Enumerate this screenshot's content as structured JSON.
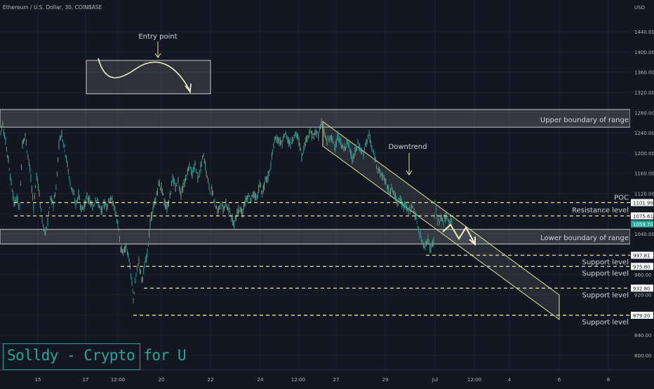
{
  "header": {
    "symbol_line": "Ethereum / U.S. Dollar, 30, COINBASE"
  },
  "colors": {
    "background": "#131722",
    "grid": "#1e222d",
    "candle": "#26a69a",
    "candle_down": "#7aa08a",
    "annotation": "#e6e39a",
    "last_price_bg": "#26a69a",
    "label_bg": "#ffffff"
  },
  "watermark": {
    "text": "Solldy - Crypto for U",
    "color": "#26a69a"
  },
  "chart_data": {
    "type": "candlestick",
    "title": "Ethereum / U.S. Dollar, 30, COINBASE",
    "currency": "USD",
    "y_ticks": [
      800,
      840,
      880,
      920,
      960,
      1000,
      1040,
      1080,
      1120,
      1160,
      1200,
      1240,
      1280,
      1320,
      1360,
      1400,
      1440
    ],
    "y_tick_labels": [
      "800.00",
      "840.00",
      "880.00",
      "920.00",
      "960.00",
      "1000.00",
      "1040.00",
      "1080.00",
      "1120.00",
      "1160.00",
      "1200.00",
      "1240.00",
      "1280.00",
      "1320.00",
      "1360.00",
      "1400.00",
      "1440.00"
    ],
    "ylim": [
      779,
      1496
    ],
    "x_ticks": [
      "15",
      "17",
      "12:00",
      "20",
      "22",
      "24",
      "12:00",
      "27",
      "29",
      "Jul",
      "12:00",
      "4",
      "6",
      "8"
    ],
    "last_price": 1059.7,
    "last_price_label": "1059.70",
    "price_series": [
      [
        0,
        1236
      ],
      [
        4,
        1258
      ],
      [
        8,
        1222
      ],
      [
        12,
        1186
      ],
      [
        16,
        1140
      ],
      [
        20,
        1102
      ],
      [
        24,
        1110
      ],
      [
        28,
        1094
      ],
      [
        32,
        1220
      ],
      [
        36,
        1234
      ],
      [
        40,
        1194
      ],
      [
        44,
        1148
      ],
      [
        48,
        1094
      ],
      [
        52,
        1156
      ],
      [
        56,
        1120
      ],
      [
        60,
        1066
      ],
      [
        64,
        1040
      ],
      [
        68,
        1062
      ],
      [
        72,
        1108
      ],
      [
        76,
        1098
      ],
      [
        80,
        1132
      ],
      [
        84,
        1220
      ],
      [
        88,
        1240
      ],
      [
        92,
        1210
      ],
      [
        96,
        1176
      ],
      [
        100,
        1140
      ],
      [
        104,
        1122
      ],
      [
        108,
        1098
      ],
      [
        112,
        1118
      ],
      [
        116,
        1090
      ],
      [
        120,
        1096
      ],
      [
        124,
        1114
      ],
      [
        128,
        1104
      ],
      [
        132,
        1092
      ],
      [
        136,
        1110
      ],
      [
        140,
        1100
      ],
      [
        144,
        1084
      ],
      [
        148,
        1100
      ],
      [
        152,
        1096
      ],
      [
        156,
        1108
      ],
      [
        160,
        1104
      ],
      [
        164,
        1086
      ],
      [
        168,
        1060
      ],
      [
        172,
        1008
      ],
      [
        176,
        1004
      ],
      [
        180,
        1016
      ],
      [
        184,
        990
      ],
      [
        188,
        940
      ],
      [
        190,
        912
      ],
      [
        194,
        958
      ],
      [
        198,
        986
      ],
      [
        202,
        948
      ],
      [
        206,
        976
      ],
      [
        210,
        1004
      ],
      [
        214,
        1060
      ],
      [
        218,
        1090
      ],
      [
        222,
        1106
      ],
      [
        226,
        1140
      ],
      [
        230,
        1132
      ],
      [
        234,
        1104
      ],
      [
        238,
        1090
      ],
      [
        242,
        1116
      ],
      [
        246,
        1150
      ],
      [
        250,
        1130
      ],
      [
        254,
        1146
      ],
      [
        258,
        1118
      ],
      [
        262,
        1138
      ],
      [
        266,
        1154
      ],
      [
        270,
        1172
      ],
      [
        274,
        1160
      ],
      [
        278,
        1176
      ],
      [
        282,
        1152
      ],
      [
        286,
        1170
      ],
      [
        290,
        1198
      ],
      [
        294,
        1160
      ],
      [
        298,
        1132
      ],
      [
        302,
        1124
      ],
      [
        306,
        1104
      ],
      [
        310,
        1084
      ],
      [
        314,
        1100
      ],
      [
        318,
        1088
      ],
      [
        322,
        1100
      ],
      [
        326,
        1086
      ],
      [
        330,
        1072
      ],
      [
        334,
        1062
      ],
      [
        338,
        1082
      ],
      [
        342,
        1090
      ],
      [
        346,
        1082
      ],
      [
        350,
        1106
      ],
      [
        354,
        1112
      ],
      [
        358,
        1108
      ],
      [
        362,
        1120
      ],
      [
        366,
        1112
      ],
      [
        370,
        1138
      ],
      [
        374,
        1120
      ],
      [
        378,
        1144
      ],
      [
        382,
        1152
      ],
      [
        386,
        1178
      ],
      [
        390,
        1216
      ],
      [
        394,
        1230
      ],
      [
        398,
        1224
      ],
      [
        402,
        1216
      ],
      [
        406,
        1238
      ],
      [
        410,
        1228
      ],
      [
        414,
        1218
      ],
      [
        418,
        1232
      ],
      [
        422,
        1236
      ],
      [
        426,
        1224
      ],
      [
        430,
        1192
      ],
      [
        434,
        1216
      ],
      [
        438,
        1232
      ],
      [
        442,
        1244
      ],
      [
        446,
        1232
      ],
      [
        450,
        1240
      ],
      [
        454,
        1236
      ],
      [
        458,
        1262
      ],
      [
        462,
        1238
      ],
      [
        466,
        1222
      ],
      [
        470,
        1230
      ],
      [
        474,
        1224
      ],
      [
        478,
        1214
      ],
      [
        482,
        1232
      ],
      [
        486,
        1220
      ],
      [
        490,
        1206
      ],
      [
        494,
        1222
      ],
      [
        498,
        1210
      ],
      [
        502,
        1186
      ],
      [
        506,
        1200
      ],
      [
        510,
        1220
      ],
      [
        514,
        1206
      ],
      [
        518,
        1198
      ],
      [
        522,
        1222
      ],
      [
        526,
        1236
      ],
      [
        530,
        1208
      ],
      [
        534,
        1190
      ],
      [
        538,
        1172
      ],
      [
        542,
        1160
      ],
      [
        546,
        1154
      ],
      [
        550,
        1140
      ],
      [
        554,
        1124
      ],
      [
        558,
        1130
      ],
      [
        562,
        1118
      ],
      [
        566,
        1104
      ],
      [
        570,
        1110
      ],
      [
        574,
        1094
      ],
      [
        578,
        1098
      ],
      [
        582,
        1082
      ],
      [
        586,
        1094
      ],
      [
        590,
        1086
      ],
      [
        594,
        1064
      ],
      [
        598,
        1040
      ],
      [
        602,
        1024
      ],
      [
        606,
        1016
      ],
      [
        610,
        1030
      ],
      [
        614,
        1008
      ],
      [
        618,
        1024
      ],
      [
        620,
        1102
      ],
      [
        624,
        1062
      ],
      [
        628,
        1072
      ],
      [
        632,
        1064
      ],
      [
        636,
        1076
      ],
      [
        640,
        1060
      ],
      [
        644,
        1068
      ]
    ],
    "annotations": {
      "entry_point": "Entry point",
      "downtrend": "Downtrend",
      "upper_boundary": "Upper boundary of range",
      "lower_boundary": "Lower boundary of range",
      "poc": "POC",
      "resistance": "Resistance level",
      "support": "Support level"
    },
    "zones": [
      {
        "name": "Upper boundary of range",
        "from": 1251,
        "to": 1286,
        "x_from": 0
      },
      {
        "name": "Lower boundary of range",
        "from": 1020,
        "to": 1049,
        "x_from": 0
      }
    ],
    "entry_box": {
      "from": 1317,
      "to": 1383,
      "x_from": 123,
      "x_to": 300
    },
    "levels": [
      {
        "label": "POC",
        "value": 1101.99,
        "price_label": "1101.99",
        "x_from": 20
      },
      {
        "label": "Resistance level",
        "value": 1075.61,
        "price_label": "1075.61",
        "x_from": 20
      },
      {
        "label": "Support level",
        "value": 997.81,
        "price_label": "997.81",
        "x_from": 607
      },
      {
        "label": "Support level",
        "value": 975.8,
        "price_label": "975.80",
        "x_from": 172
      },
      {
        "label": "Support level",
        "value": 932.8,
        "price_label": "932.80",
        "x_from": 205
      },
      {
        "label": "Support level",
        "value": 879.2,
        "price_label": "879.20",
        "x_from": 190
      }
    ]
  }
}
